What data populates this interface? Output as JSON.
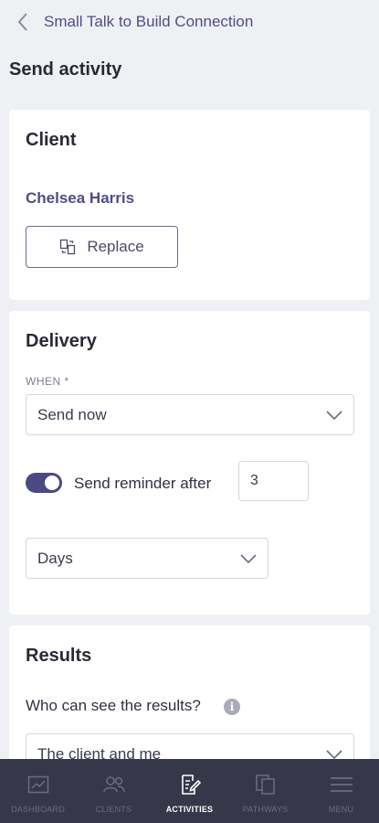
{
  "header": {
    "title": "Small Talk to Build Connection",
    "back_icon": "chevron-left-icon"
  },
  "page_title": "Send activity",
  "client_card": {
    "title": "Client",
    "client_name": "Chelsea Harris",
    "replace_label": "Replace"
  },
  "delivery_card": {
    "title": "Delivery",
    "when_label": "WHEN *",
    "when_value": "Send now",
    "reminder_label": "Send reminder after",
    "reminder_enabled": true,
    "reminder_value": "3",
    "unit_value": "Days"
  },
  "results_card": {
    "title": "Results",
    "question": "Who can see the results?",
    "info_glyph": "i",
    "visibility_value": "The client and me"
  },
  "nav": {
    "items": [
      {
        "label": "DASHBOARD",
        "icon": "chart-icon",
        "active": false
      },
      {
        "label": "CLIENTS",
        "icon": "people-icon",
        "active": false
      },
      {
        "label": "ACTIVITIES",
        "icon": "document-edit-icon",
        "active": true
      },
      {
        "label": "PATHWAYS",
        "icon": "copy-icon",
        "active": false
      },
      {
        "label": "MENU",
        "icon": "hamburger-icon",
        "active": false
      }
    ]
  },
  "colors": {
    "accent": "#4f4d86",
    "background": "#eef0f4",
    "nav_background": "#363849",
    "toggle_on": "#4a4a82"
  }
}
